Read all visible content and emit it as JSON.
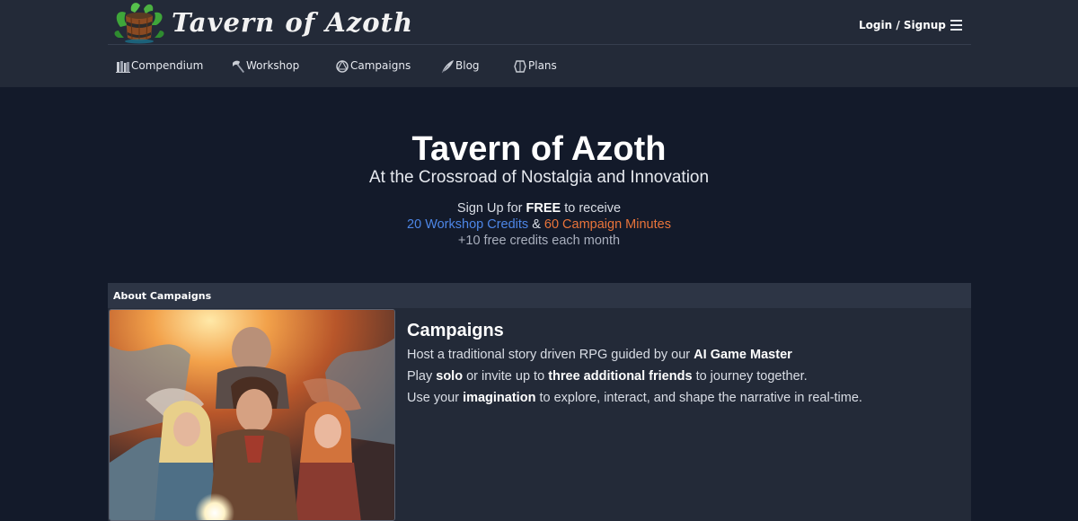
{
  "brand": {
    "name": "Tavern of Azoth",
    "logo_icon": "potion-barrel-icon"
  },
  "header": {
    "login_label": "Login / Signup",
    "menu_icon": "hamburger-menu-icon"
  },
  "nav": {
    "items": [
      {
        "label": "Compendium",
        "icon": "books-icon"
      },
      {
        "label": "Workshop",
        "icon": "axe-icon"
      },
      {
        "label": "Campaigns",
        "icon": "d20-dice-icon"
      },
      {
        "label": "Blog",
        "icon": "quill-icon"
      },
      {
        "label": "Plans",
        "icon": "gem-icon"
      }
    ]
  },
  "hero": {
    "title": "Tavern of Azoth",
    "subtitle": "At the Crossroad of Nostalgia and Innovation",
    "signup_prefix": "Sign Up for",
    "signup_free": "FREE",
    "signup_suffix": "to receive",
    "workshop_credits": "20 Workshop Credits",
    "amp": "&",
    "campaign_minutes": "60 Campaign Minutes",
    "monthly": "+10 free credits each month"
  },
  "about": {
    "header": "About Campaigns",
    "title": "Campaigns",
    "line1_a": "Host a traditional story driven RPG guided by our",
    "line1_b": "AI Game Master",
    "line2_a": "Play",
    "line2_b": "solo",
    "line2_c": "or invite up to",
    "line2_d": "three additional friends",
    "line2_e": "to journey together.",
    "line3_a": "Use your",
    "line3_b": "imagination",
    "line3_c": "to explore, interact, and shape the narrative in real-time."
  },
  "colors": {
    "page_bg": "#131a2a",
    "header_bg": "#232a38",
    "accent_blue": "#4d86e6",
    "accent_orange": "#e9743a"
  }
}
